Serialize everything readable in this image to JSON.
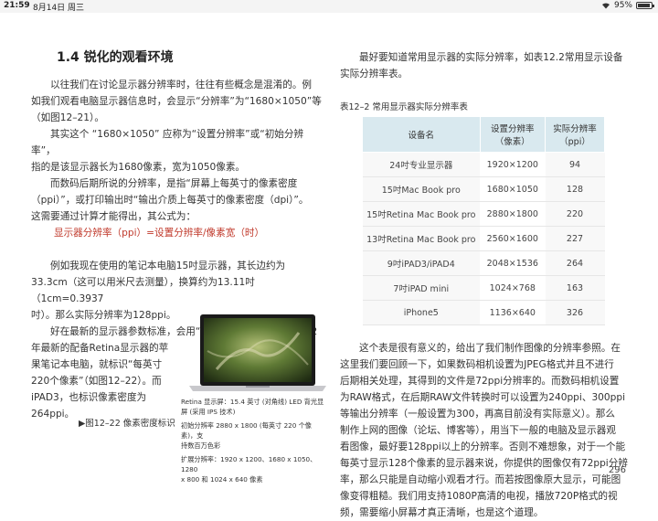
{
  "status_bar": {
    "time": "21:59",
    "date": "8月14日 周三",
    "battery": "95%",
    "battery_level": 0.95
  },
  "section_title": "1.4 锐化的观看环境",
  "left": {
    "para1": [
      "以往我们在讨论显示器分辨率时，往往有些概念是混淆的。例",
      "如我们观看电脑显示器信息时，会显示“分辨率”为“1680×1050”等",
      "（如图12–21）。"
    ],
    "para2": [
      "其实这个 “1680×1050” 应称为“设置分辨率”或“初始分辨率”，",
      "指的是该显示器长为1680像素，宽为1050像素。"
    ],
    "para3": [
      "而数码后期所说的分辨率，是指“屏幕上每英寸的像素密度",
      "（ppi）”，或打印输出时“输出介质上每英寸的像素密度（dpi）”。",
      "这需要通过计算才能得出，其公式为："
    ],
    "formula": "显示器分辨率（ppi）=设置分辨率/像素宽（时）",
    "para4": [
      "例如我现在使用的笔记本电脑15吋显示器，其长边约为",
      "33.3cm（这可以用米尺去测量），换算约为13.11吋（1cm=0.3937",
      "吋）。那么实际分辨率为128ppi。"
    ],
    "para5_full": [
      "好在最新的显示器参数标准，会用“像素密度”来标识，如2012",
      "年最新的配备Retina显示器的苹"
    ],
    "para5_narrow": [
      "果笔记本电脑，就标识“每英寸",
      "220个像素”（如图12–22）。而",
      "iPAD3，也标识像素密度为",
      "264ppi。"
    ],
    "figure_caption": "▶图12–22 像素密度标识",
    "spec_lines": [
      "Retina 显示屏：15.4 英寸 (对角线) LED 背光显",
      "屏 (采用 IPS 技术)",
      "",
      "初始分辨率 2880 x 1800 (每英寸 220 个像素)，支",
      "持数百万色彩",
      "",
      "扩展分辨率：1920 x 1200、1680 x 1050、1280",
      "x 800 和 1024 x 640 像素"
    ]
  },
  "right": {
    "intro": [
      "最好要知道常用显示器的实际分辨率，如表12.2常用显示设备",
      "实际分辨率表。"
    ],
    "table_title": "表12–2 常用显示器实际分辨率表",
    "table": {
      "headers": [
        "设备名",
        "设置分辨率\n（像素）",
        "实际分辨率\n（ppi）"
      ],
      "rows": [
        [
          "24吋专业显示器",
          "1920×1200",
          "94"
        ],
        [
          "15吋Mac Book pro",
          "1680×1050",
          "128"
        ],
        [
          "15吋Retina Mac Book pro",
          "2880×1800",
          "220"
        ],
        [
          "13吋Retina Mac Book pro",
          "2560×1600",
          "227"
        ],
        [
          "9吋iPAD3/iPAD4",
          "2048×1536",
          "264"
        ],
        [
          "7吋iPAD mini",
          "1024×768",
          "163"
        ],
        [
          "iPhone5",
          "1136×640",
          "326"
        ]
      ]
    },
    "para": [
      "这个表是很有意义的，给出了我们制作图像的分辨率参照。在",
      "这里我们要回顾一下，如果数码相机设置为JPEG格式并且不进行",
      "后期相关处理，其得到的文件是72ppi分辨率的。而数码相机设置",
      "为RAW格式，在后期RAW文件转换时可以设置为240ppi、300ppi",
      "等输出分辨率（一般设置为300，再高目前没有实际意义）。那么",
      "制作上网的图像（论坛、博客等），用当下一般的电脑及显示器观",
      "看图像，最好要128ppi以上的分辨率。否则不难想象，对于一个能",
      "每英寸显示128个像素的显示器来说，你提供的图像仅有72ppi分辨",
      "率，那么只能是自动缩小观看才行。而若按图像原大显示，可能图",
      "像变得粗糙。我们用支持1080P高清的电视，播放720P格式的视",
      "频，需要缩小屏幕才真正清晰，也是这个道理。"
    ],
    "page_number": "296"
  }
}
